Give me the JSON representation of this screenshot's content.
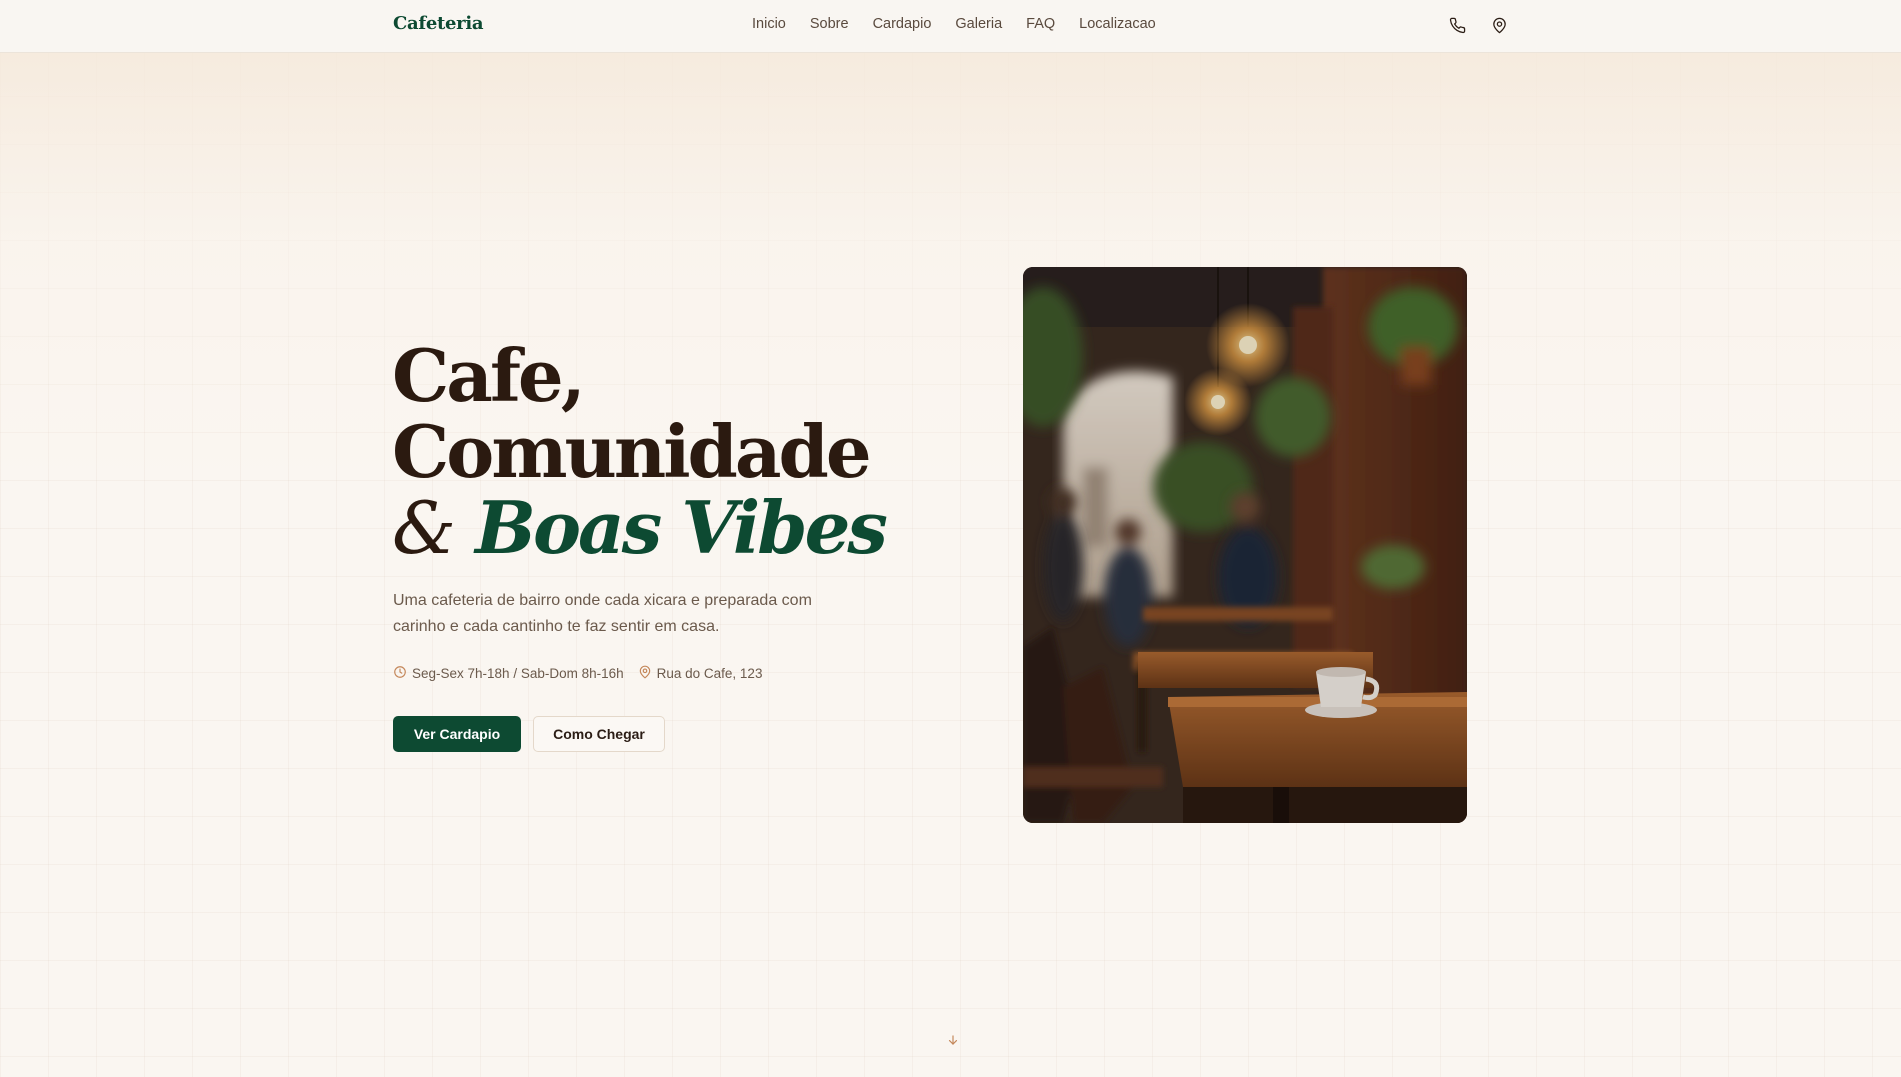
{
  "nav": {
    "brand": "Cafeteria",
    "links": [
      "Inicio",
      "Sobre",
      "Cardapio",
      "Galeria",
      "FAQ",
      "Localizacao"
    ],
    "icons": [
      "phone-icon",
      "map-pin-icon"
    ]
  },
  "hero": {
    "title_line1": "Cafe,",
    "title_line2": "Comunidade",
    "title_amp": "&",
    "title_accent": "Boas Vibes",
    "description": "Uma cafeteria de bairro onde cada xicara e preparada com carinho e cada cantinho te faz sentir em casa.",
    "hours": "Seg-Sex 7h-18h / Sab-Dom 8h-16h",
    "address": "Rua do Cafe, 123",
    "primary_button": "Ver Cardapio",
    "secondary_button": "Como Chegar"
  },
  "colors": {
    "brand_green": "#0d4a32",
    "heading_brown": "#2b1a10",
    "text_muted": "#6b5a4c",
    "icon_accent": "#c4875a",
    "background": "#faf6f1"
  }
}
